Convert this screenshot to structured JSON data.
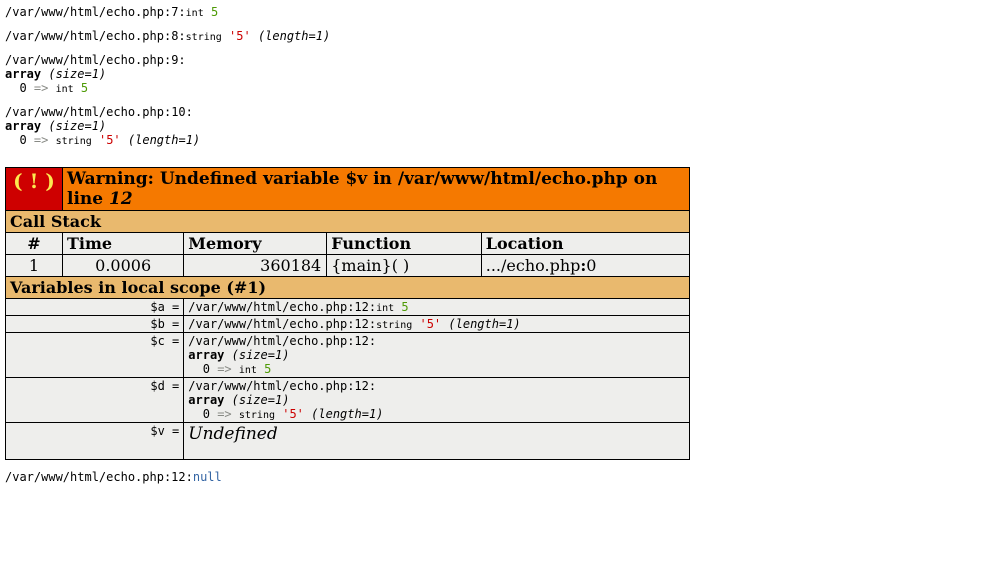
{
  "dumps": {
    "d1": {
      "file": "/var/www/html/echo.php",
      "line": "7",
      "type": "int",
      "value": "5"
    },
    "d2": {
      "file": "/var/www/html/echo.php",
      "line": "8",
      "type": "string",
      "value": "'5'",
      "length": "(length=1)"
    },
    "d3": {
      "file": "/var/www/html/echo.php",
      "line": "9",
      "arr": "array",
      "size": "(size=1)",
      "key": "0",
      "arrow": "=>",
      "etype": "int",
      "eval": "5"
    },
    "d4": {
      "file": "/var/www/html/echo.php",
      "line": "10",
      "arr": "array",
      "size": "(size=1)",
      "key": "0",
      "arrow": "=>",
      "etype": "string",
      "eval": "'5'",
      "elen": "(length=1)"
    }
  },
  "warning": {
    "bang": "( ! )",
    "text": "Warning: Undefined variable $v in /var/www/html/echo.php on line ",
    "line": "12"
  },
  "callstack": {
    "header": "Call Stack",
    "cols": {
      "num": "#",
      "time": "Time",
      "memory": "Memory",
      "func": "Function",
      "loc": "Location"
    },
    "row": {
      "num": "1",
      "time": "0.0006",
      "memory": "360184",
      "func": "{main}( )",
      "loc_pre": ".../echo.php",
      "loc_b": ":",
      "loc_post": "0"
    }
  },
  "vars": {
    "header": "Variables in local scope (#1)",
    "a": {
      "label": "$a =",
      "file": "/var/www/html/echo.php:12:",
      "type": "int",
      "val": "5"
    },
    "b": {
      "label": "$b =",
      "file": "/var/www/html/echo.php:12:",
      "type": "string",
      "val": "'5'",
      "len": "(length=1)"
    },
    "c": {
      "label": "$c =",
      "file": "/var/www/html/echo.php:12:",
      "arr": "array",
      "size": "(size=1)",
      "key": "0",
      "arrow": "=>",
      "etype": "int",
      "eval": "5"
    },
    "d": {
      "label": "$d =",
      "file": "/var/www/html/echo.php:12:",
      "arr": "array",
      "size": "(size=1)",
      "key": "0",
      "arrow": "=>",
      "etype": "string",
      "eval": "'5'",
      "elen": "(length=1)"
    },
    "v": {
      "label": "$v =",
      "val": "Undefined"
    }
  },
  "trailer": {
    "file": "/var/www/html/echo.php:12:",
    "val": "null"
  }
}
